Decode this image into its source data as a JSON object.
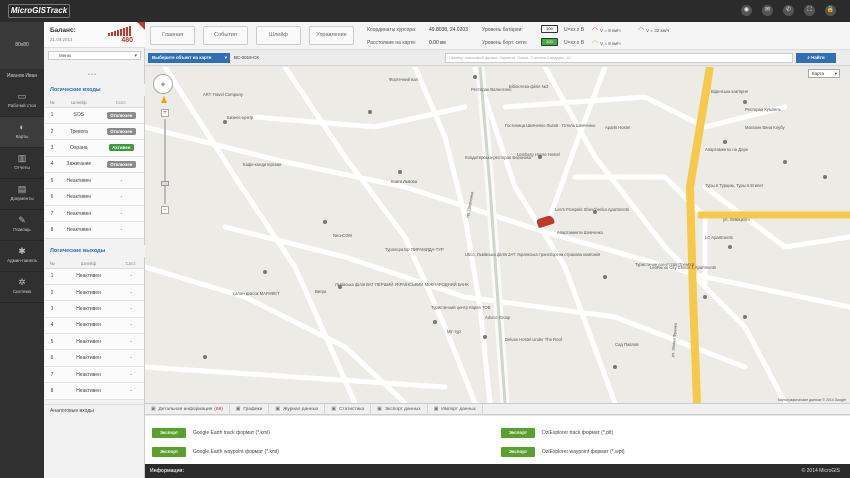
{
  "app": {
    "logo": "MicroGISTrack"
  },
  "topbar": {
    "icons": [
      "help-icon",
      "mail-icon",
      "phone-icon",
      "fullscreen-icon",
      "lock-icon"
    ],
    "icon_glyphs": [
      "◉",
      "✉",
      "✆",
      "⛶",
      "🔒"
    ]
  },
  "user": {
    "avatar_label": "80x80",
    "name": "Иванов Иван"
  },
  "sidebar": {
    "items": [
      {
        "label": "Рабочий стол",
        "glyph": "▭",
        "icon": "desktop-icon"
      },
      {
        "label": "Карты",
        "glyph": "◐",
        "icon": "globe-icon"
      },
      {
        "label": "Отчеты",
        "glyph": "▥",
        "icon": "bar-chart-icon"
      },
      {
        "label": "Документы",
        "glyph": "▤",
        "icon": "documents-icon"
      },
      {
        "label": "Помощь",
        "glyph": "✎",
        "icon": "chat-icon"
      },
      {
        "label": "Админ-панель",
        "glyph": "✱",
        "icon": "gear-icon"
      },
      {
        "label": "Система",
        "glyph": "✲",
        "icon": "settings-icon"
      }
    ]
  },
  "balance": {
    "label": "Баланс:",
    "date": "21.04.2014",
    "amount": "480"
  },
  "menu": {
    "label": "Меню"
  },
  "logic_inputs": {
    "title": "Логические входы",
    "headers": [
      "№",
      "Шлейф",
      "Сост."
    ],
    "rows": [
      {
        "n": "1",
        "name": "SOS",
        "state": "Отключен",
        "status": "off"
      },
      {
        "n": "2",
        "name": "Тревога",
        "state": "Отключен",
        "status": "off"
      },
      {
        "n": "3",
        "name": "Охрана",
        "state": "Активен",
        "status": "on"
      },
      {
        "n": "4",
        "name": "Зажигание",
        "state": "Отключен",
        "status": "off"
      },
      {
        "n": "5",
        "name": "Неактивен",
        "state": "-",
        "status": "none"
      },
      {
        "n": "6",
        "name": "Неактивен",
        "state": "-",
        "status": "none"
      },
      {
        "n": "7",
        "name": "Неактивен",
        "state": "-",
        "status": "none"
      },
      {
        "n": "8",
        "name": "Неактивен",
        "state": "-",
        "status": "none"
      }
    ]
  },
  "logic_outputs": {
    "title": "Логические выходы",
    "headers": [
      "№",
      "Шлейф",
      "Сост."
    ],
    "rows": [
      {
        "n": "1",
        "name": "Неактивен",
        "state": "-"
      },
      {
        "n": "2",
        "name": "Неактивен",
        "state": "-"
      },
      {
        "n": "3",
        "name": "Неактивен",
        "state": "-"
      },
      {
        "n": "4",
        "name": "Неактивен",
        "state": "-"
      },
      {
        "n": "5",
        "name": "Неактивен",
        "state": "-"
      },
      {
        "n": "6",
        "name": "Неактивен",
        "state": "-"
      },
      {
        "n": "7",
        "name": "Неактивен",
        "state": "-"
      },
      {
        "n": "8",
        "name": "Неактивен",
        "state": "-"
      }
    ]
  },
  "analog_inputs": {
    "title": "Аналоговые входы"
  },
  "header": {
    "tabs": [
      "Главная",
      "События",
      "Шлейф",
      "Управление"
    ],
    "coords_label": "Координаты курсора:",
    "coords_value": "49.8038, 24.0203",
    "distance_label": "Расстояние на карте:",
    "distance_value": "0.00 км",
    "battery_label": "Уровень батареи:",
    "battery_value": "100",
    "battery_unit": "U=xx.x B",
    "net_label": "Уровень борт. сети:",
    "net_value": "100",
    "net_unit": "U=xx.x B",
    "speed1": "V = 8 км/ч",
    "speed2": "V = 8 км/ч",
    "speed3": "V = 32 км/ч"
  },
  "search": {
    "select_label": "Выберите объект на карте",
    "object_value": "ВС-0019-СК",
    "placeholder": "Пример поисковой фразы: Украина, Львов, Степана Бандеры, 16",
    "find_label": "Найти"
  },
  "map": {
    "type": "Карта",
    "copyright": "Картографические данные © 2014 Google",
    "labels": [
      "ART Travel Company",
      "Бизнес-центр",
      "Кафе-кондитерская",
      "Neo-COM",
      "Туроператор ПИРАМИДА-ТУР",
      "Гостиница Шевченко Львов - Готель Шевченко",
      "Lemberg House Hostel",
      "Leo's Prospekt Shevchenka Apartments",
      "Utico, Львівська філія ЗАТ Українська транспортна страхова компанія",
      "Львівська філія ВАТ ПЕРШИЙ УКРАЇНСЬКИЙ МІЖНАРОДНИЙ БАНК",
      "Туристичний центр Корея ТОВ",
      "Advice Group",
      "Deluxe Hostel Under The Roof",
      "Кондитерська-ресторан Вероника",
      "Бібліотека-філія №3",
      "Ресторан Валентино",
      "Фортечний вал",
      "Туристичне агентство Прем'єр",
      "Aparts Hostel",
      "LC Apartments",
      "LeoRenta City Center 1 Apartments",
      "Віденська кав'ярня",
      "Ресторан Кумпель",
      "Магазин Вина Клубу",
      "Туры в Турцию, Туры в Египет",
      "Апартаменты на Доре",
      "Сад Павлов",
      "ул. Ивана Франко",
      "ул. Левицкого",
      "пр. Шевченко",
      "салон красок МАРАФЕТ",
      "Вигра",
      "Книги Львова",
      "Міг-тур",
      "Апартаменти Шевченко"
    ]
  },
  "bottom_tabs": {
    "items": [
      {
        "label": "Детальная информация",
        "count": "(68)",
        "icon": "info-icon"
      },
      {
        "label": "Графики",
        "count": "",
        "icon": "chart-icon"
      },
      {
        "label": "Журнал данных",
        "count": "",
        "icon": "journal-icon"
      },
      {
        "label": "Статистика",
        "count": "",
        "icon": "statistics-icon"
      },
      {
        "label": "Экспорт данных",
        "count": "",
        "icon": "export-icon"
      },
      {
        "label": "Импорт данных",
        "count": "",
        "icon": "import-icon"
      }
    ]
  },
  "export": {
    "button_label": "Экспорт",
    "items": [
      "Google Earth track формат (*.kml)",
      "OziExplorer track формат (*.plt)",
      "Google Earth waypoint формат (*.kml)",
      "OziExplorer waypoint формат (*.wpt)"
    ]
  },
  "footer": {
    "info_label": "Информация:",
    "copyright": "© 2014 MicroGIS"
  },
  "colors": {
    "accent": "#2f6fb3",
    "danger": "#c0392b",
    "success": "#3c9a3c",
    "export": "#5aa02c",
    "dark": "#2b2b2b"
  }
}
